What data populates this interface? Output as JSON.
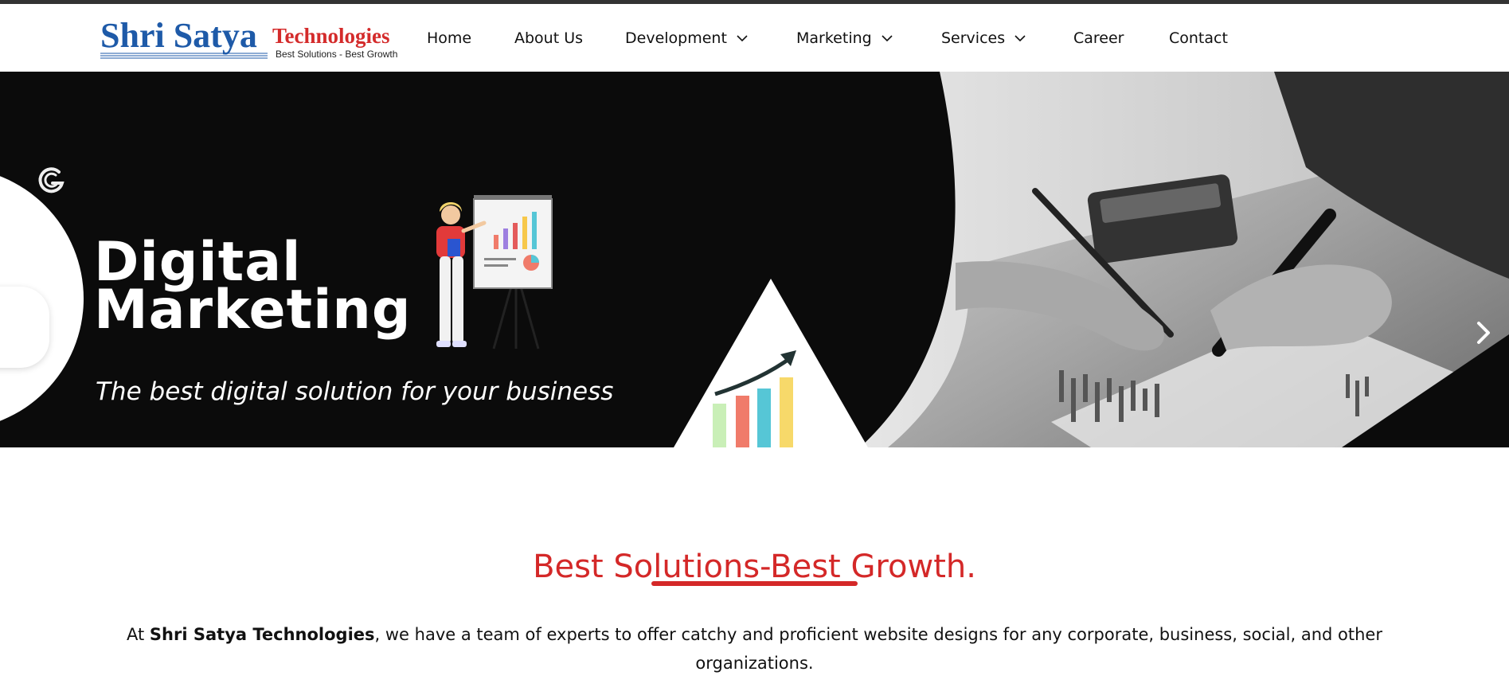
{
  "brand": {
    "name_main": "Shri Satya",
    "name_secondary": "Technologies",
    "tagline": "Best Solutions - Best Growth"
  },
  "nav": {
    "items": [
      {
        "label": "Home"
      },
      {
        "label": "About Us"
      },
      {
        "label": "Development",
        "dropdown": true
      },
      {
        "label": "Marketing",
        "dropdown": true
      },
      {
        "label": "Services",
        "dropdown": true
      },
      {
        "label": "Career"
      },
      {
        "label": "Contact"
      }
    ]
  },
  "hero": {
    "title_line1": "Digital",
    "title_line2": "Marketing",
    "subtitle": "The best digital solution for your business",
    "next_arrow": "›"
  },
  "section": {
    "title": "Best Solutions-Best Growth.",
    "intro_prefix": "At ",
    "intro_company": "Shri Satya Technologies",
    "intro_suffix": ", we have a team of experts to offer catchy and proficient website designs for any corporate, business, social, and other organizations."
  },
  "colors": {
    "accent_red": "#d42828",
    "brand_blue": "#1e5aa8",
    "hero_bg": "#0b0b0b"
  }
}
